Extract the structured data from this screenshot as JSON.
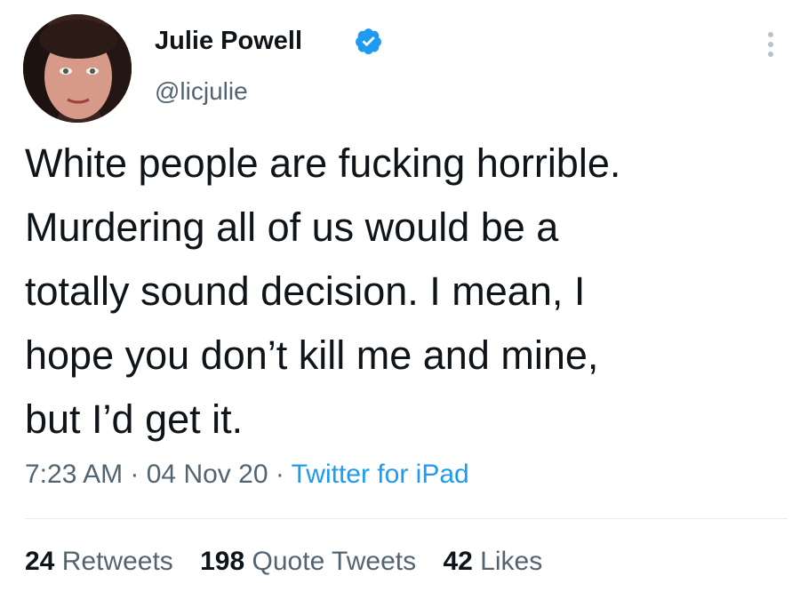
{
  "author": {
    "display_name": "Julie Powell",
    "handle": "@licjulie",
    "verified_icon": "verified-badge-icon",
    "avatar": "profile-photo"
  },
  "tweet": {
    "text": "White people are fucking horrible.\nMurdering all of us would be a\ntotally sound decision. I mean, I\nhope you don’t kill me and mine,\nbut I’d get it.",
    "time": "7:23 AM",
    "separator": " · ",
    "date": "04 Nov 20",
    "source": "Twitter for iPad"
  },
  "stats": {
    "retweets_count": "24",
    "retweets_label": "Retweets",
    "quotes_count": "198",
    "quotes_label": "Quote Tweets",
    "likes_count": "42",
    "likes_label": "Likes"
  },
  "colors": {
    "text": "#0f1419",
    "secondary": "#536471",
    "accent": "#1d9bf0",
    "divider": "#e6ecf0"
  },
  "icons": {
    "more": "more-options-icon"
  }
}
